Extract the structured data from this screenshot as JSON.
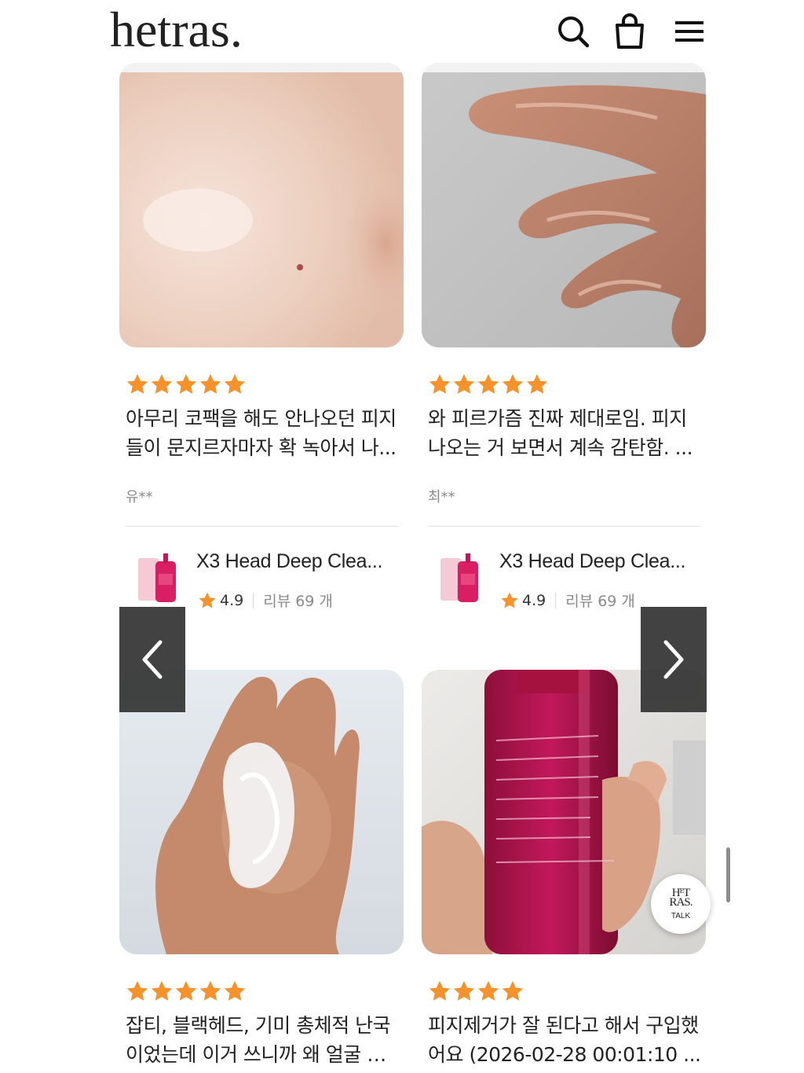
{
  "header": {
    "logo": "hetras.",
    "icons": [
      "search-icon",
      "shopping-bag-icon",
      "menu-icon"
    ]
  },
  "colors": {
    "star": "#F6922B",
    "arrow_bg": "#333333",
    "text": "#222222",
    "muted": "#8A8A8A"
  },
  "reviews": [
    {
      "rating": 5,
      "line1": "아무리 코팩을 해도 안나오던 피지",
      "line2": "들이 문지르자마자 확 녹아서 나...",
      "author": "유**",
      "product": {
        "name": "X3 Head Deep Clea...",
        "rating": "4.9",
        "review_count": "리뷰 69 개"
      },
      "photo": "skin-closeup"
    },
    {
      "rating": 5,
      "line1": "와 피르가즘 진짜 제대로임. 피지",
      "line2": "나오는 거 보면서 계속 감탄함. ...",
      "author": "최**",
      "product": {
        "name": "X3 Head Deep Clea...",
        "rating": "4.9",
        "review_count": "리뷰 69 개"
      },
      "photo": "oily-fingers"
    },
    {
      "rating": 5,
      "line1": "잡티, 블랙헤드, 기미 총체적 난국",
      "line2": "이었는데 이거 쓰니까 왜 얼굴 하...",
      "photo": "hand-with-foam"
    },
    {
      "rating": 4,
      "line1": "피지제거가 잘 된다고 해서 구입했",
      "line2": "어요 (2026-02-28 00:01:10 ...",
      "photo": "bottle-in-hand"
    }
  ],
  "carousel": {
    "prev_icon": "chevron-left-icon",
    "next_icon": "chevron-right-icon"
  },
  "talk": {
    "logo": "HETRAS",
    "label": "TALK"
  }
}
